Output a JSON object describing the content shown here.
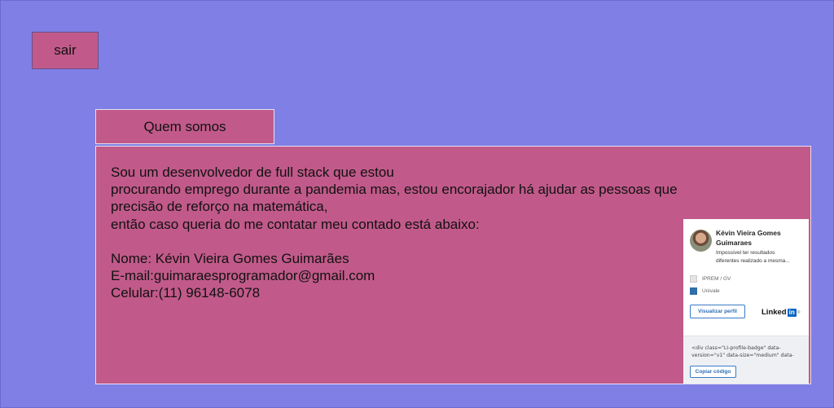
{
  "logout_label": "sair",
  "section_tab": "Quem somos",
  "about": {
    "line1": "Sou um desenvolvedor de full stack  que estou",
    "line2": "procurando emprego durante a pandemia mas, estou encorajador há ajudar as pessoas que",
    "line3": "precisão de reforço na matemática,",
    "line4": "então caso queria do me contatar meu contado está abaixo:",
    "name": "Nome: Kévin Vieira Gomes Guimarães",
    "email": "E-mail:guimaraesprogramador@gmail.com",
    "phone": "Celular:(11) 96148-6078"
  },
  "linkedin_badge": {
    "name": "Kévin Vieira Gomes Guimaraes",
    "headline": "Impossível ter resultados diferentes realizado a mesma...",
    "org1": "IPREM / GV",
    "org2": "Univale",
    "view_button": "Visualizar perfil",
    "logo_text": "Linked",
    "logo_in": "in",
    "logo_dot": "®",
    "code_snippet": "<div class=\"LI-profile-badge\"  data-version=\"v1\" data-size=\"medium\" data-",
    "copy_button": "Copiar código"
  },
  "colors": {
    "background": "#7f7fe5",
    "panel": "#c15a8a",
    "linkedin_blue": "#0a66c2"
  }
}
